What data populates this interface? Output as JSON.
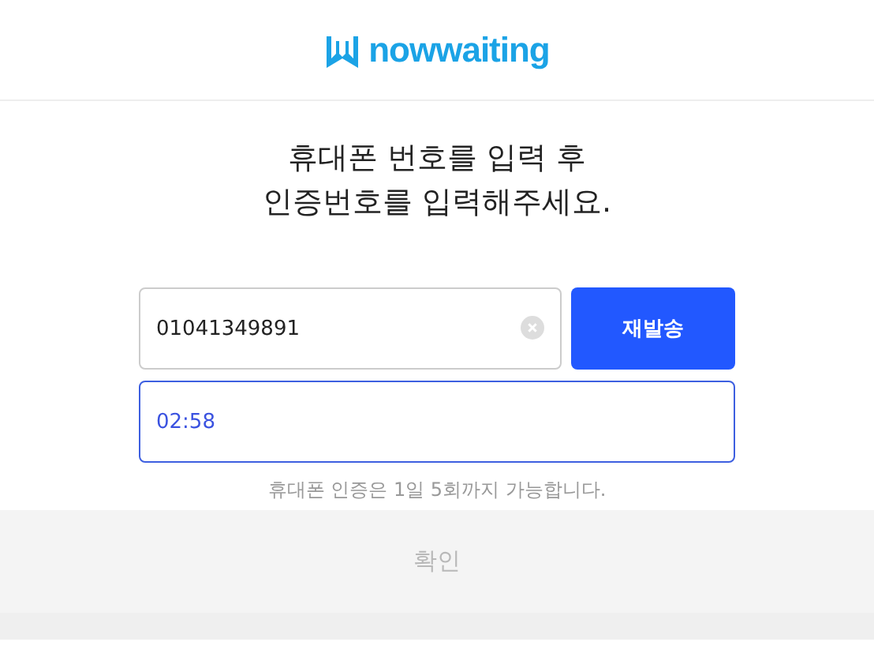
{
  "header": {
    "logo_text": "nowwaiting"
  },
  "title_lines": [
    "휴대폰 번호를 입력 후",
    "인증번호를 입력해주세요."
  ],
  "phone_field": {
    "value": "01041349891"
  },
  "resend_button": {
    "label": "재발송"
  },
  "code_field": {
    "timer": "02:58"
  },
  "note": "휴대폰 인증은 1일 5회까지 가능합니다.",
  "confirm_button": {
    "label": "확인",
    "disabled": true
  }
}
